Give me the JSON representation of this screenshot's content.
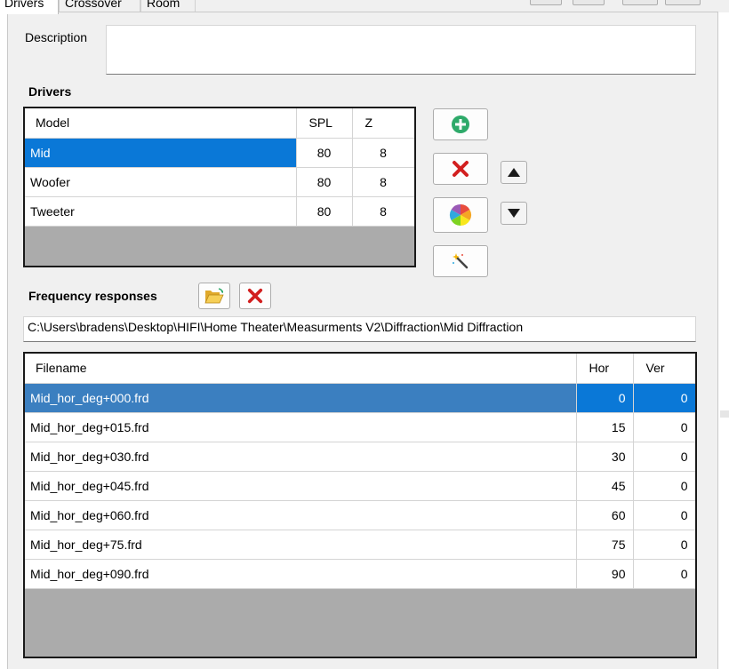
{
  "tabs": [
    {
      "label": "Drivers",
      "active": true
    },
    {
      "label": "Crossover",
      "active": false
    },
    {
      "label": "Room",
      "active": false
    }
  ],
  "description": {
    "label": "Description",
    "value": ""
  },
  "drivers": {
    "section_label": "Drivers",
    "columns": [
      "Model",
      "SPL",
      "Z"
    ],
    "rows": [
      {
        "model": "Mid",
        "spl": "80",
        "z": "8",
        "selected": true
      },
      {
        "model": "Woofer",
        "spl": "80",
        "z": "8",
        "selected": false
      },
      {
        "model": "Tweeter",
        "spl": "80",
        "z": "8",
        "selected": false
      }
    ],
    "buttons": {
      "add": "plus-circle-icon",
      "remove": "red-x-icon",
      "color": "color-wheel-icon",
      "wizard": "magic-wand-icon",
      "move_up": "triangle-up-icon",
      "move_down": "triangle-down-icon"
    }
  },
  "frequency_responses": {
    "section_label": "Frequency responses",
    "path": "C:\\Users\\bradens\\Desktop\\HIFI\\Home Theater\\Measurments V2\\Diffraction\\Mid Diffraction",
    "columns": [
      "Filename",
      "Hor",
      "Ver"
    ],
    "rows": [
      {
        "filename": "Mid_hor_deg+000.frd",
        "hor": "0",
        "ver": "0",
        "selected": true
      },
      {
        "filename": "Mid_hor_deg+015.frd",
        "hor": "15",
        "ver": "0",
        "selected": false
      },
      {
        "filename": "Mid_hor_deg+030.frd",
        "hor": "30",
        "ver": "0",
        "selected": false
      },
      {
        "filename": "Mid_hor_deg+045.frd",
        "hor": "45",
        "ver": "0",
        "selected": false
      },
      {
        "filename": "Mid_hor_deg+060.frd",
        "hor": "60",
        "ver": "0",
        "selected": false
      },
      {
        "filename": "Mid_hor_deg+75.frd",
        "hor": "75",
        "ver": "0",
        "selected": false
      },
      {
        "filename": "Mid_hor_deg+090.frd",
        "hor": "90",
        "ver": "0",
        "selected": false
      }
    ],
    "buttons": {
      "open": "folder-open-icon",
      "remove": "red-x-icon"
    }
  },
  "colors": {
    "selection": "#0a78d7",
    "selection_inactive": "#3b7fc0",
    "panel": "#f0f0f0",
    "grid_empty": "#ababab",
    "add_green": "#2eaa6a",
    "delete_red": "#d21f1f"
  }
}
